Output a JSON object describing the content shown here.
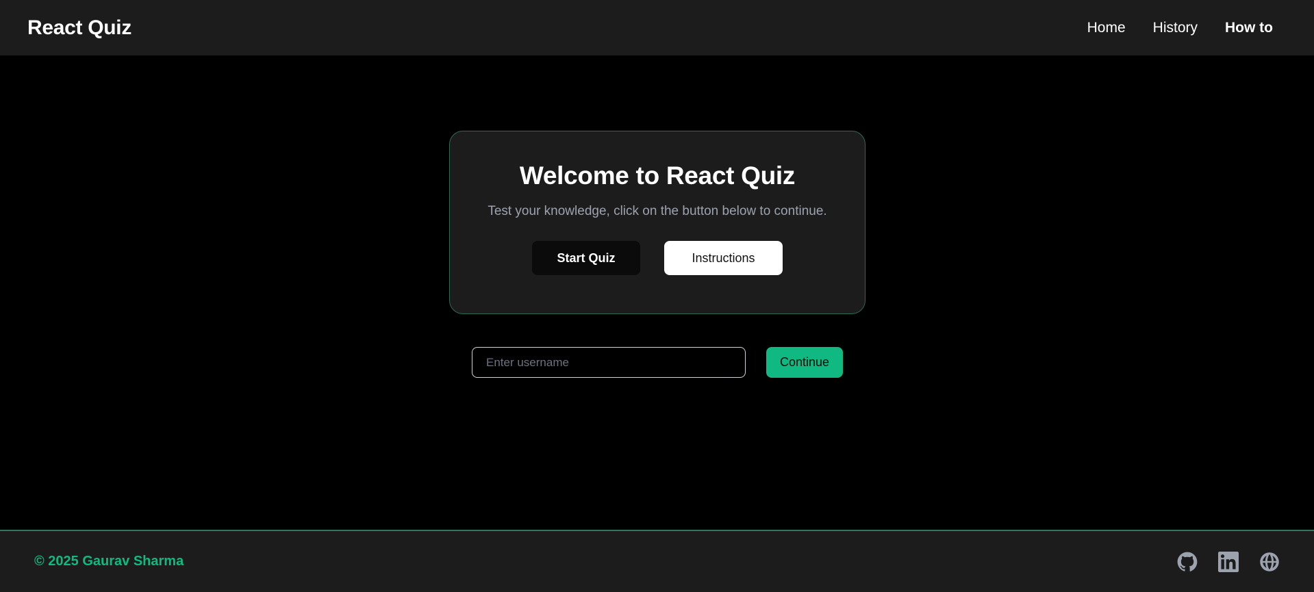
{
  "header": {
    "brand": "React Quiz",
    "nav": [
      {
        "label": "Home"
      },
      {
        "label": "History"
      },
      {
        "label": "How to"
      }
    ]
  },
  "welcome_card": {
    "title": "Welcome to React Quiz",
    "subtitle": "Test your knowledge, click on the button below to continue.",
    "start_label": "Start Quiz",
    "instructions_label": "Instructions"
  },
  "username_form": {
    "placeholder": "Enter username",
    "value": "",
    "continue_label": "Continue"
  },
  "footer": {
    "copyright": "© 2025 Gaurav Sharma",
    "socials": [
      "github-icon",
      "linkedin-icon",
      "globe-icon"
    ]
  },
  "colors": {
    "accent": "#10b981",
    "surface": "#1c1c1c",
    "background": "#000000",
    "muted_text": "#9ca3af"
  }
}
